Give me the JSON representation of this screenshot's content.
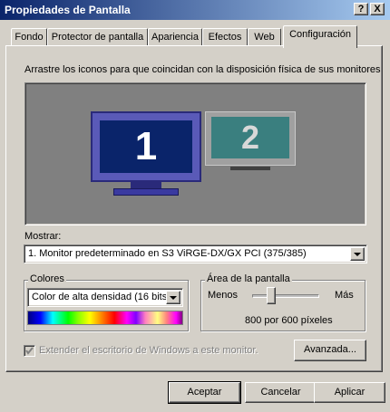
{
  "window": {
    "title": "Propiedades de Pantalla",
    "help_label": "?",
    "close_label": "X"
  },
  "tabs": [
    {
      "label": "Fondo"
    },
    {
      "label": "Protector de pantalla"
    },
    {
      "label": "Apariencia"
    },
    {
      "label": "Efectos"
    },
    {
      "label": "Web"
    },
    {
      "label": "Configuración",
      "active": true
    }
  ],
  "instruction": "Arrastre los iconos para que coincidan con la disposición física de sus monitores",
  "monitors": [
    {
      "number": "1",
      "selected": true
    },
    {
      "number": "2",
      "selected": false
    }
  ],
  "display": {
    "label": "Mostrar:",
    "value": "1. Monitor predeterminado en S3 ViRGE-DX/GX PCI (375/385)"
  },
  "colors": {
    "group_label": "Colores",
    "value": "Color de alta densidad (16 bits)"
  },
  "screen_area": {
    "group_label": "Área de la pantalla",
    "less_label": "Menos",
    "more_label": "Más",
    "resolution": "800 por 600 píxeles",
    "slider_level": 0.25
  },
  "extend_desktop": {
    "label": "Extender el escritorio de Windows a este monitor.",
    "checked": true,
    "enabled": false
  },
  "advanced_button": "Avanzada...",
  "buttons": {
    "ok": "Aceptar",
    "cancel": "Cancelar",
    "apply": "Aplicar"
  },
  "colors_theme": {
    "titlebar_start": "#0a246a",
    "titlebar_end": "#a6caf0",
    "face": "#d4d0c8",
    "monitor1_screen": "#0a246a",
    "monitor2_screen": "#3a7f7f"
  }
}
